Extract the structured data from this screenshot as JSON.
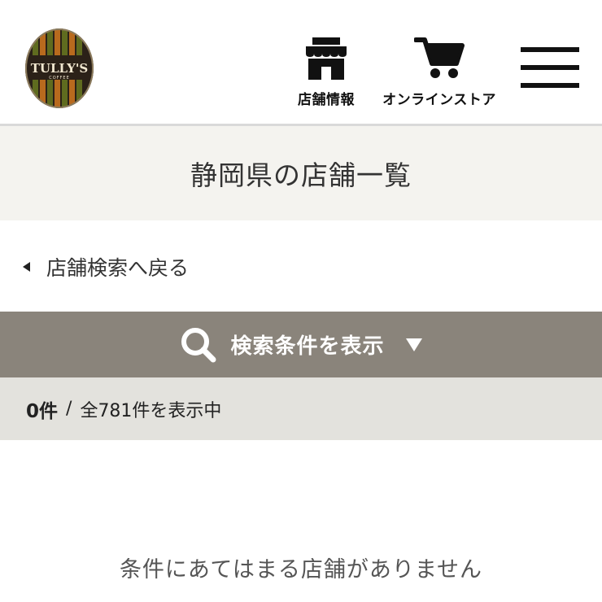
{
  "header": {
    "logo_text": "TULLY'S",
    "logo_subtext": "COFFEE",
    "nav": {
      "store_info_label": "店舗情報",
      "online_store_label": "オンラインストア"
    }
  },
  "page": {
    "title": "静岡県の店舗一覧",
    "back_link_label": "店舗検索へ戻る"
  },
  "search": {
    "toggle_label": "検索条件を表示"
  },
  "results": {
    "count_shown": "0件",
    "separator": "/",
    "total_text": "全781件を表示中",
    "empty_message": "条件にあてはまる店舗がありません"
  },
  "colors": {
    "search_bar": "#8a847b",
    "title_band": "#f4f3ef",
    "count_bar": "#e3e2dd",
    "logo_dark": "#2b2118",
    "logo_stripe_green": "#5f6b1f",
    "logo_stripe_orange": "#b86a1e"
  }
}
